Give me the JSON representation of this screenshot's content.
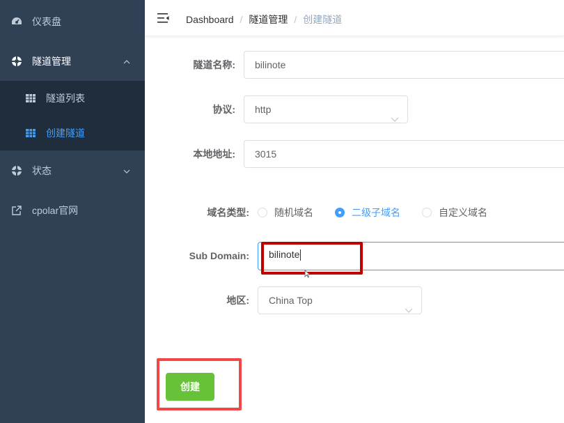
{
  "sidebar": {
    "items": [
      {
        "label": "仪表盘",
        "icon": "dashboard-icon"
      },
      {
        "label": "隧道管理",
        "icon": "tunnel-icon",
        "expanded": true
      },
      {
        "label": "状态",
        "icon": "status-icon",
        "expanded": false
      },
      {
        "label": "cpolar官网",
        "icon": "external-link-icon"
      }
    ],
    "sub_items": [
      {
        "label": "隧道列表",
        "icon": "table-icon",
        "active": false
      },
      {
        "label": "创建隧道",
        "icon": "table-icon",
        "active": true
      }
    ]
  },
  "navbar": {
    "breadcrumb": [
      "Dashboard",
      "隧道管理",
      "创建隧道"
    ],
    "separator": "/"
  },
  "form": {
    "tunnel_name": {
      "label": "隧道名称:",
      "value": "bilinote"
    },
    "protocol": {
      "label": "协议:",
      "value": "http"
    },
    "local_address": {
      "label": "本地地址:",
      "value": "3015"
    },
    "domain_type": {
      "label": "域名类型:",
      "options": [
        "随机域名",
        "二级子域名",
        "自定义域名"
      ],
      "selected": "二级子域名"
    },
    "sub_domain": {
      "label": "Sub Domain:",
      "value": "bilinote"
    },
    "region": {
      "label": "地区:",
      "value": "China Top"
    },
    "submit_label": "创建"
  },
  "colors": {
    "sidebar_bg": "#304156",
    "submenu_bg": "#1f2d3d",
    "active": "#409eff",
    "success": "#67c23a",
    "highlight_dark": "#c00000",
    "highlight_light": "#f04848"
  }
}
